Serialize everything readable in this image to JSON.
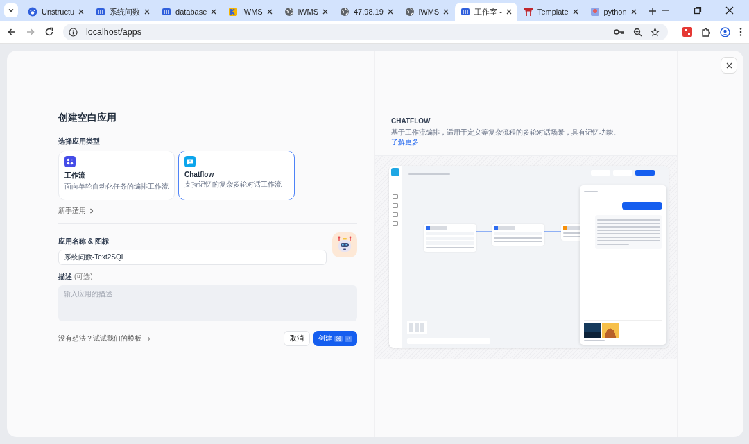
{
  "browser": {
    "tabs": [
      {
        "title": "Unstructu",
        "kind": "paw",
        "selected": false
      },
      {
        "title": "系统问数",
        "kind": "dify",
        "selected": false
      },
      {
        "title": "database",
        "kind": "dify",
        "selected": false
      },
      {
        "title": "iWMS",
        "kind": "letter",
        "selected": false
      },
      {
        "title": "iWMS",
        "kind": "globe",
        "selected": false
      },
      {
        "title": "47.98.19",
        "kind": "globe",
        "selected": false
      },
      {
        "title": "iWMS",
        "kind": "globe",
        "selected": false
      },
      {
        "title": "工作室 -",
        "kind": "dify",
        "selected": true
      },
      {
        "title": "Template",
        "kind": "gate",
        "selected": false
      },
      {
        "title": "python",
        "kind": "image",
        "selected": false
      }
    ],
    "url": "localhost/apps"
  },
  "dialog": {
    "title": "创建空白应用",
    "type_label": "选择应用类型",
    "app_types": [
      {
        "name": "工作流",
        "description": "面向单轮自动化任务的编排工作流",
        "kind": "workflow",
        "selected": false
      },
      {
        "name": "Chatflow",
        "description": "支持记忆的复杂多轮对话工作流",
        "kind": "chatflow",
        "selected": true
      }
    ],
    "beginner_link": "新手适用",
    "name_label": "应用名称 & 图标",
    "name_value": "系统问数-Text2SQL",
    "description_label": "描述",
    "description_optional": "(可选)",
    "description_placeholder": "输入应用的描述",
    "template_link": "没有想法？试试我们的模板",
    "cancel": "取消",
    "create": "创建",
    "create_keys": [
      "⌘",
      "↵"
    ]
  },
  "info": {
    "heading": "CHATFLOW",
    "text": "基于工作流编排，适用于定义等复杂流程的多轮对话场景，具有记忆功能。",
    "learn_more": "了解更多"
  }
}
